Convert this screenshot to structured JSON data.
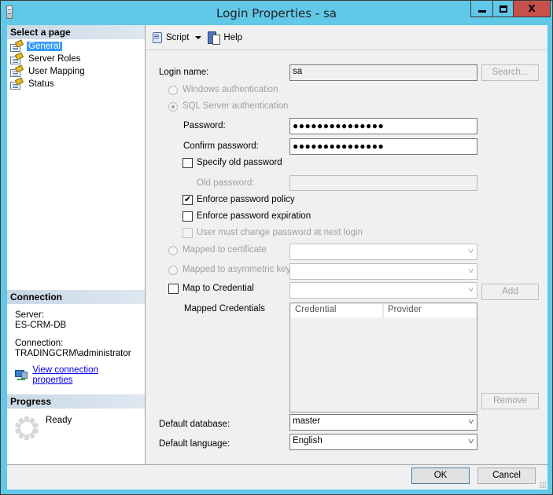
{
  "window": {
    "title": "Login Properties - sa",
    "controls": {
      "minimize": "minimize",
      "maximize": "maximize",
      "close": "X"
    }
  },
  "sidebar": {
    "select_header": "Select a page",
    "pages": [
      {
        "label": "General",
        "selected": true
      },
      {
        "label": "Server Roles",
        "selected": false
      },
      {
        "label": "User Mapping",
        "selected": false
      },
      {
        "label": "Status",
        "selected": false
      }
    ],
    "connection": {
      "header": "Connection",
      "server_label": "Server:",
      "server_value": "ES-CRM-DB",
      "connection_label": "Connection:",
      "connection_value": "TRADINGCRM\\administrator",
      "link": "View connection properties"
    },
    "progress": {
      "header": "Progress",
      "status": "Ready"
    }
  },
  "toolbar": {
    "script_label": "Script",
    "help_label": "Help"
  },
  "form": {
    "login_name_label": "Login name:",
    "login_name_value": "sa",
    "search_button": "Search...",
    "windows_auth": "Windows authentication",
    "sql_auth": "SQL Server authentication",
    "password_label": "Password:",
    "password_value": "●●●●●●●●●●●●●●●",
    "confirm_label": "Confirm password:",
    "confirm_value": "●●●●●●●●●●●●●●●",
    "specify_old_label": "Specify old password",
    "old_password_label": "Old password:",
    "old_password_value": "",
    "enforce_policy_label": "Enforce password policy",
    "enforce_policy_checked": true,
    "enforce_expiration_label": "Enforce password expiration",
    "enforce_expiration_checked": false,
    "must_change_label": "User must change password at next login",
    "mapped_cert_label": "Mapped to certificate",
    "mapped_cert_value": "",
    "mapped_asym_label": "Mapped to asymmetric key",
    "mapped_asym_value": "",
    "map_credential_label": "Map to Credential",
    "map_credential_value": "",
    "add_button": "Add",
    "mapped_credentials_label": "Mapped Credentials",
    "credentials_columns": [
      "Credential",
      "Provider"
    ],
    "credentials_rows": [],
    "remove_button": "Remove",
    "default_db_label": "Default database:",
    "default_db_value": "master",
    "default_lang_label": "Default language:",
    "default_lang_value": "English"
  },
  "footer": {
    "ok": "OK",
    "cancel": "Cancel"
  },
  "colors": {
    "title_bar": "#61c8e8",
    "close_button": "#c7504a",
    "selection": "#3399ff",
    "link": "#0000ee"
  }
}
